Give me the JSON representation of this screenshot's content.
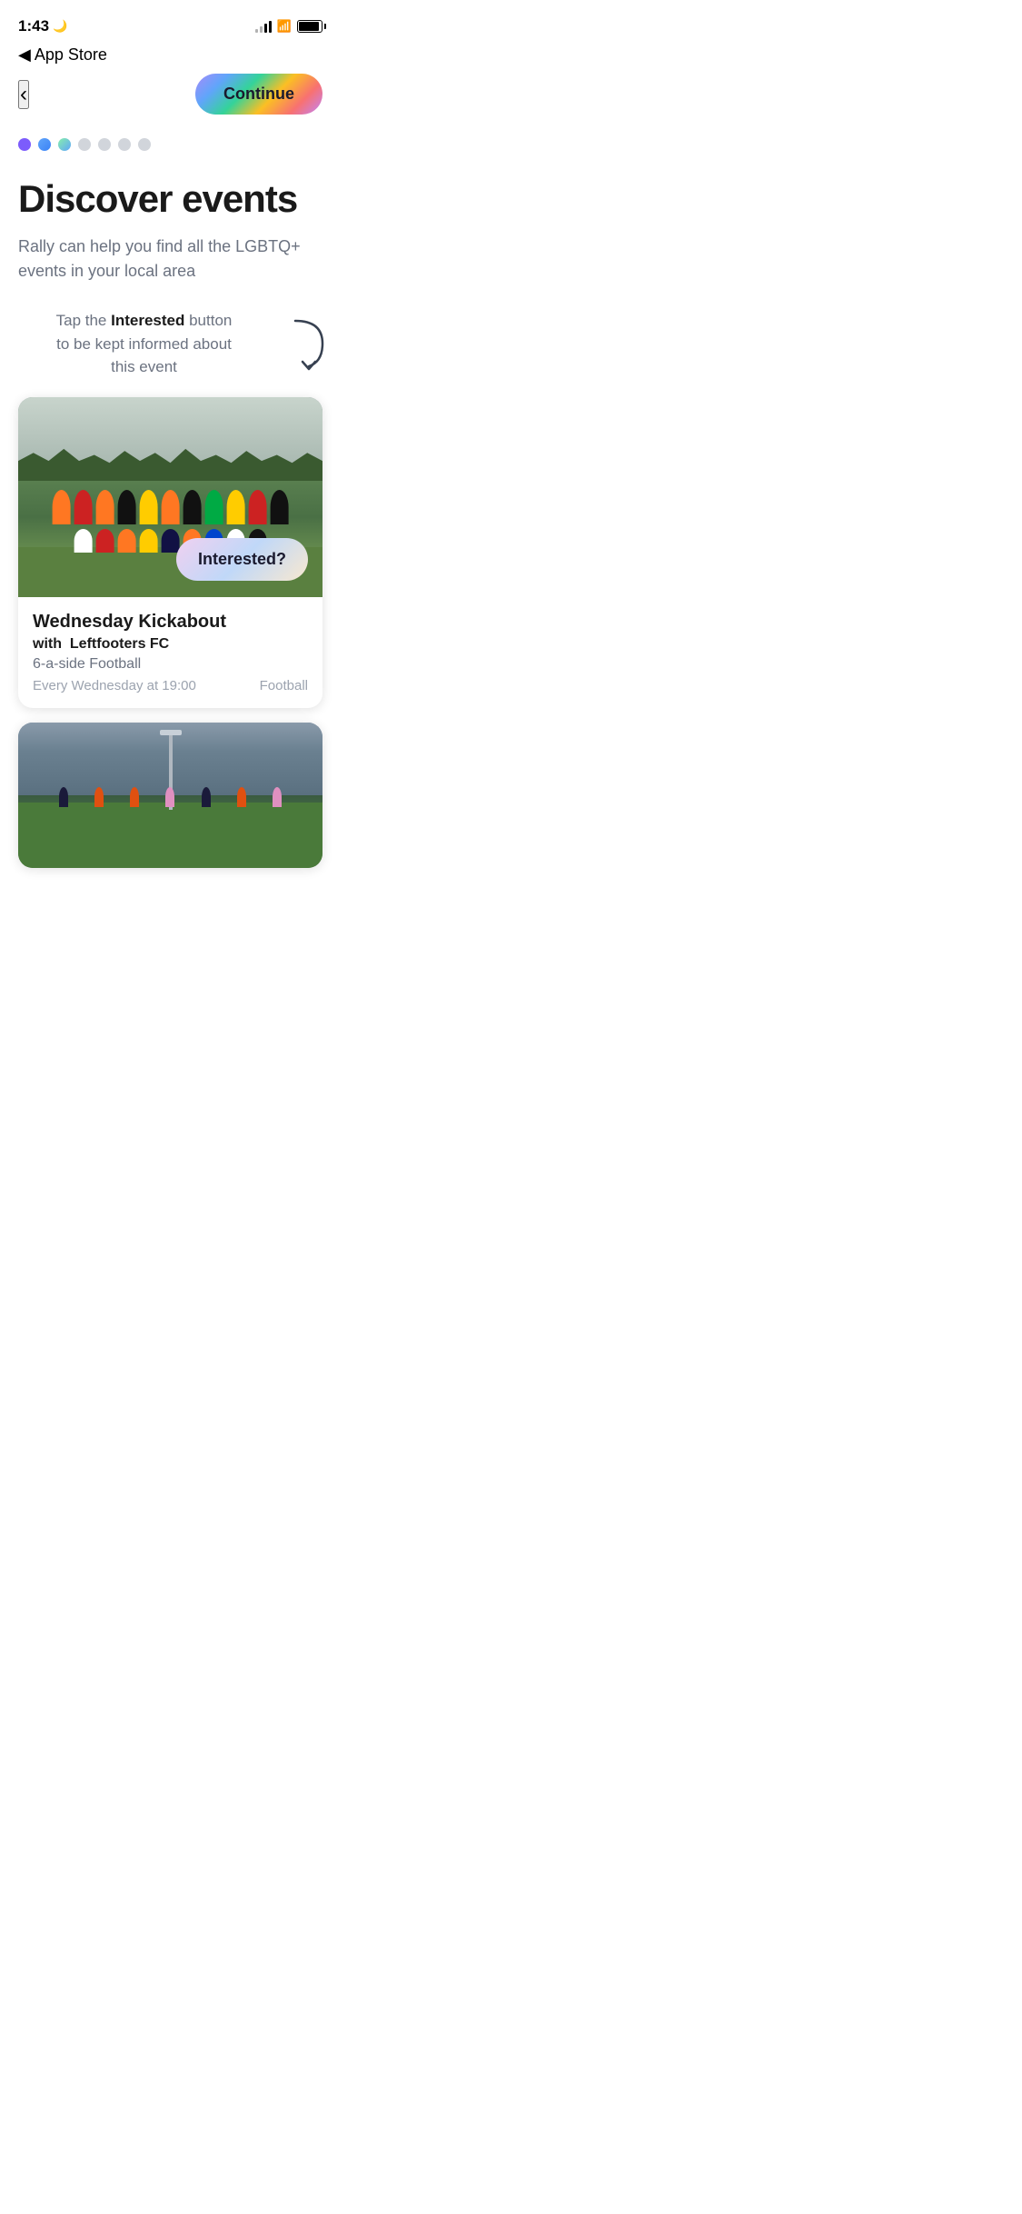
{
  "status_bar": {
    "time": "1:43",
    "moon": "🌙"
  },
  "nav": {
    "back_label": "App Store",
    "continue_label": "Continue"
  },
  "progress": {
    "dots": [
      "active-purple",
      "active-blue",
      "active-teal",
      "inactive",
      "inactive",
      "inactive",
      "inactive"
    ]
  },
  "page": {
    "title": "Discover events",
    "subtitle": "Rally can help you find all the LGBTQ+ events in your local area"
  },
  "instruction": {
    "text_before": "Tap the ",
    "bold_text": "Interested",
    "text_after": " button to be kept informed about this event"
  },
  "events": [
    {
      "title": "Wednesday Kickabout",
      "organizer_prefix": "with",
      "organizer": "Leftfooters FC",
      "type": "6-a-side Football",
      "schedule": "Every Wednesday at 19:00",
      "category": "Football",
      "interested_label": "Interested?"
    }
  ]
}
